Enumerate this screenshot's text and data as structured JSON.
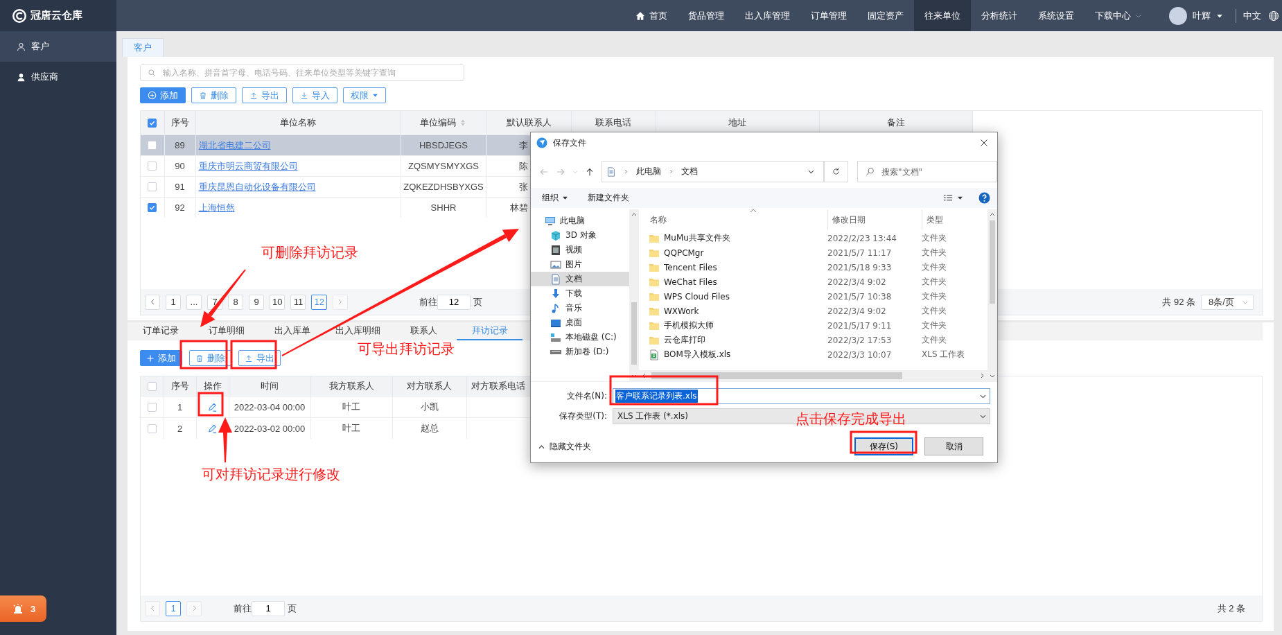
{
  "logo": "冠唐云仓库",
  "topnav": {
    "items": [
      {
        "label": "首页",
        "selected": false
      },
      {
        "label": "货品管理",
        "selected": false
      },
      {
        "label": "出入库管理",
        "selected": false
      },
      {
        "label": "订单管理",
        "selected": false
      },
      {
        "label": "固定资产",
        "selected": false
      },
      {
        "label": "往来单位",
        "selected": true
      },
      {
        "label": "分析统计",
        "selected": false
      },
      {
        "label": "系统设置",
        "selected": false
      },
      {
        "label": "下载中心",
        "selected": false
      }
    ],
    "user": "叶辉",
    "language": "中文"
  },
  "sidebar": {
    "items": [
      {
        "label": "客户",
        "selected": true
      },
      {
        "label": "供应商",
        "selected": false
      }
    ],
    "alarm_count": "3"
  },
  "page_tabs": [
    {
      "label": "客户",
      "selected": true
    }
  ],
  "customers": {
    "search": {
      "placeholder": "输入名称、拼音首字母、电话号码、往来单位类型等关键字查询"
    },
    "buttons": [
      {
        "label": "添加",
        "kind": "primary"
      },
      {
        "label": "删除",
        "kind": "delete"
      },
      {
        "label": "导出",
        "kind": "export"
      },
      {
        "label": "导入",
        "kind": "import"
      },
      {
        "label": "权限",
        "kind": "dropdown"
      }
    ],
    "all_checked": true,
    "columns": [
      {
        "label": "序号",
        "sortable": false
      },
      {
        "label": "单位名称",
        "sortable": false
      },
      {
        "label": "单位编码",
        "sortable": true
      },
      {
        "label": "默认联系人",
        "sortable": false
      },
      {
        "label": "联系电话",
        "sortable": false
      },
      {
        "label": "地址",
        "sortable": false
      },
      {
        "label": "备注",
        "sortable": false
      }
    ],
    "rows": [
      {
        "checked": false,
        "selected": true,
        "cells": [
          "89",
          "湖北省电建二公司",
          "HBSDJEGS",
          "李"
        ]
      },
      {
        "checked": false,
        "selected": false,
        "cells": [
          "90",
          "重庆市明云商贸有限公司",
          "ZQSMYSMYXGS",
          "陈"
        ]
      },
      {
        "checked": false,
        "selected": false,
        "cells": [
          "91",
          "重庆昆恩自动化设备有限公司",
          "ZQKEZDHSBYXGS",
          "张"
        ]
      },
      {
        "checked": true,
        "selected": false,
        "cells": [
          "92",
          "上海恒然",
          "SHHR",
          "林碧"
        ]
      }
    ],
    "pagination": {
      "prev_disabled": false,
      "next_disabled": true,
      "pages": [
        {
          "label": "1",
          "selected": false
        },
        {
          "label": "...",
          "selected": false
        },
        {
          "label": "7",
          "selected": false
        },
        {
          "label": "8",
          "selected": false
        },
        {
          "label": "9",
          "selected": false
        },
        {
          "label": "10",
          "selected": false
        },
        {
          "label": "11",
          "selected": false
        },
        {
          "label": "12",
          "selected": true
        }
      ],
      "goto_label": "前往",
      "goto_value": "12",
      "goto_suffix": "页",
      "total": "共 92 条",
      "page_size": "8条/页"
    }
  },
  "detail_tabs": [
    {
      "label": "订单记录",
      "selected": false
    },
    {
      "label": "订单明细",
      "selected": false
    },
    {
      "label": "出入库单",
      "selected": false
    },
    {
      "label": "出入库明细",
      "selected": false
    },
    {
      "label": "联系人",
      "selected": false
    },
    {
      "label": "拜访记录",
      "selected": true
    }
  ],
  "visits": {
    "buttons": [
      {
        "label": "添加",
        "kind": "add"
      },
      {
        "label": "删除",
        "kind": "delete"
      },
      {
        "label": "导出",
        "kind": "export"
      }
    ],
    "all_checked": false,
    "columns": [
      "序号",
      "操作",
      "时间",
      "我方联系人",
      "对方联系人",
      "对方联系电话"
    ],
    "rows": [
      {
        "checked": false,
        "cells": [
          "1",
          "",
          "2022-03-04 00:00",
          "叶工",
          "小凯"
        ]
      },
      {
        "checked": false,
        "cells": [
          "2",
          "",
          "2022-03-02 00:00",
          "叶工",
          "赵总"
        ]
      }
    ],
    "pagination": {
      "prev_disabled": true,
      "next_disabled": true,
      "pages": [
        {
          "label": "1",
          "selected": true
        }
      ],
      "goto_label": "前往",
      "goto_value": "1",
      "goto_suffix": "页",
      "total": "共 2 条"
    }
  },
  "save_dialog": {
    "title": "保存文件",
    "path": [
      "此电脑",
      "文档"
    ],
    "search": {
      "placeholder": "搜索\"文档\""
    },
    "toolbar": [
      "组织",
      "新建文件夹"
    ],
    "nav": [
      {
        "label": "此电脑",
        "selected": false
      },
      {
        "label": "3D 对象",
        "selected": false
      },
      {
        "label": "视频",
        "selected": false
      },
      {
        "label": "图片",
        "selected": false
      },
      {
        "label": "文档",
        "selected": true
      },
      {
        "label": "下载",
        "selected": false
      },
      {
        "label": "音乐",
        "selected": false
      },
      {
        "label": "桌面",
        "selected": false
      },
      {
        "label": "本地磁盘 (C:)",
        "selected": false
      },
      {
        "label": "新加卷 (D:)",
        "selected": false
      }
    ],
    "columns": [
      "名称",
      "修改日期",
      "类型"
    ],
    "files": [
      {
        "kind": "folder",
        "name": "MuMu共享文件夹",
        "date": "2022/2/23 13:44",
        "type": "文件夹"
      },
      {
        "kind": "folder",
        "name": "QQPCMgr",
        "date": "2021/5/7 11:17",
        "type": "文件夹"
      },
      {
        "kind": "folder",
        "name": "Tencent Files",
        "date": "2021/5/18 9:33",
        "type": "文件夹"
      },
      {
        "kind": "folder",
        "name": "WeChat Files",
        "date": "2022/3/4 9:02",
        "type": "文件夹"
      },
      {
        "kind": "folder",
        "name": "WPS Cloud Files",
        "date": "2021/5/7 10:38",
        "type": "文件夹"
      },
      {
        "kind": "folder",
        "name": "WXWork",
        "date": "2022/3/4 9:02",
        "type": "文件夹"
      },
      {
        "kind": "folder",
        "name": "手机模拟大师",
        "date": "2021/5/17 9:11",
        "type": "文件夹"
      },
      {
        "kind": "folder",
        "name": "云仓库打印",
        "date": "2022/3/2 17:53",
        "type": "文件夹"
      },
      {
        "kind": "xls",
        "name": "BOM导入模板.xls",
        "date": "2022/3/3 10:07",
        "type": "XLS 工作表"
      }
    ],
    "file_name": {
      "label": "文件名(N):",
      "value": "客户联系记录列表.xls"
    },
    "file_type": {
      "label": "保存类型(T):",
      "value": "XLS 工作表 (*.xls)"
    },
    "hide_folders": "隐藏文件夹",
    "buttons": [
      {
        "label": "保存(S)",
        "kind": "primary"
      },
      {
        "label": "取消",
        "kind": "default"
      }
    ]
  },
  "annotations": [
    {
      "text": "可删除拜访记录"
    },
    {
      "text": "可导出拜访记录"
    },
    {
      "text": "可对拜访记录进行修改"
    },
    {
      "text": "点击保存完成导出"
    }
  ]
}
